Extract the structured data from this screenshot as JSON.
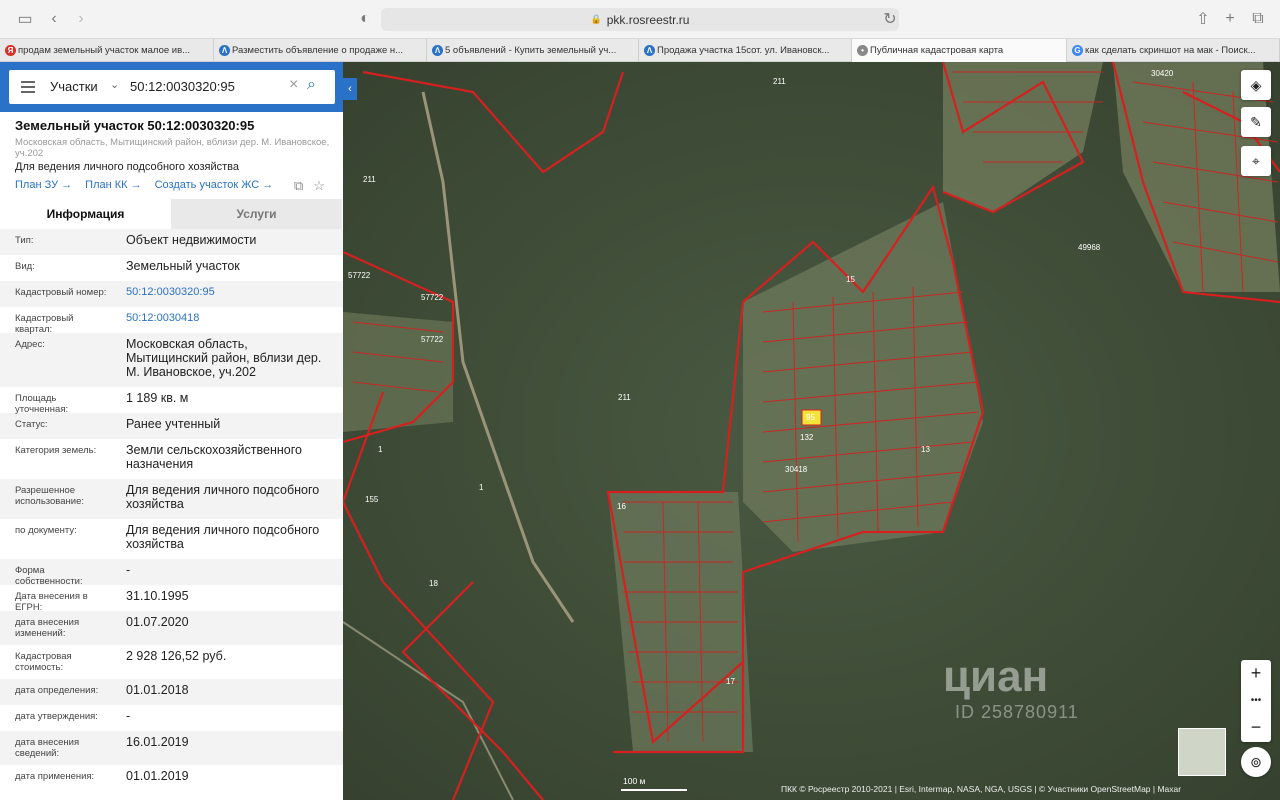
{
  "browser": {
    "url": "pkk.rosreestr.ru",
    "tabs": [
      {
        "label": "продам земельный участок малое ив...",
        "fav": "Я",
        "fav_color": "#d93025",
        "w": 214
      },
      {
        "label": "Разместить объявление о продаже н...",
        "fav": "Λ",
        "fav_color": "#2a72c7",
        "w": 213
      },
      {
        "label": "5 объявлений - Купить земельный уч...",
        "fav": "Λ",
        "fav_color": "#2a72c7",
        "w": 212
      },
      {
        "label": "Продажа участка 15сот. ул. Ивановск...",
        "fav": "Λ",
        "fav_color": "#2a72c7",
        "w": 213
      },
      {
        "label": "Публичная кадастровая карта",
        "fav": "•",
        "fav_color": "#888888",
        "w": 215
      },
      {
        "label": "как сделать скриншот на мак - Поиск...",
        "fav": "G",
        "fav_color": "#4285f4",
        "w": 213
      }
    ]
  },
  "search": {
    "type": "Участки",
    "value": "50:12:0030320:95"
  },
  "object": {
    "title": "Земельный участок 50:12:0030320:95",
    "address": "Московская область, Мытищинский район, вблизи дер. М. Ивановское, уч.202",
    "use": "Для ведения личного подсобного хозяйства",
    "links": [
      "План ЗУ",
      "План КК",
      "Создать участок ЖС"
    ]
  },
  "panel_tabs": {
    "info": "Информация",
    "services": "Услуги"
  },
  "info_rows": [
    {
      "label": "Тип:",
      "value": "Объект недвижимости"
    },
    {
      "label": "Вид:",
      "value": "Земельный участок"
    },
    {
      "label": "Кадастровый номер:",
      "value": "50:12:0030320:95",
      "link": true
    },
    {
      "label": "Кадастровый квартал:",
      "value": "50:12:0030418",
      "link": true
    },
    {
      "label": "Адрес:",
      "value": "Московская область, Мытищинский район, вблизи дер. М. Ивановское, уч.202"
    },
    {
      "label": "Площадь уточненная:",
      "value": "1 189 кв. м"
    },
    {
      "label": "Статус:",
      "value": "Ранее учтенный"
    },
    {
      "label": "Категория земель:",
      "value": "Земли сельскохозяйственного назначения"
    },
    {
      "label": "Разрешенное использование:",
      "value": "Для ведения личного подсобного хозяйства"
    },
    {
      "label": "по документу:",
      "value": "Для ведения личного подсобного хозяйства"
    },
    {
      "label": "Форма собственности:",
      "value": "-"
    },
    {
      "label": "Дата внесения в ЕГРН:",
      "value": "31.10.1995"
    },
    {
      "label": "дата внесения изменений:",
      "value": "01.07.2020"
    },
    {
      "label": "Кадастровая стоимость:",
      "value": "2 928 126,52 руб."
    },
    {
      "label": "дата определения:",
      "value": "01.01.2018"
    },
    {
      "label": "дата утверждения:",
      "value": "-"
    },
    {
      "label": "дата внесения сведений:",
      "value": "16.01.2019"
    },
    {
      "label": "дата применения:",
      "value": "01.01.2019"
    }
  ],
  "map": {
    "scale": "100 м",
    "attribution": "ПКК © Росреестр 2010-2021 | Esri, Intermap, NASA, NGA, USGS | © Участники OpenStreetMap | Maxar",
    "watermark": "циан",
    "watermark_id": "ID 258780911",
    "labels": [
      "211",
      "211",
      "211",
      "57722",
      "57722",
      "57722",
      "49968",
      "30420",
      "30418",
      "1",
      "1",
      "155",
      "18",
      "16",
      "95",
      "15",
      "17",
      "132",
      "13"
    ],
    "highlight_color": "#f2e33a",
    "border_color": "#d6201f"
  },
  "colors": {
    "accent": "#2a72c7"
  }
}
